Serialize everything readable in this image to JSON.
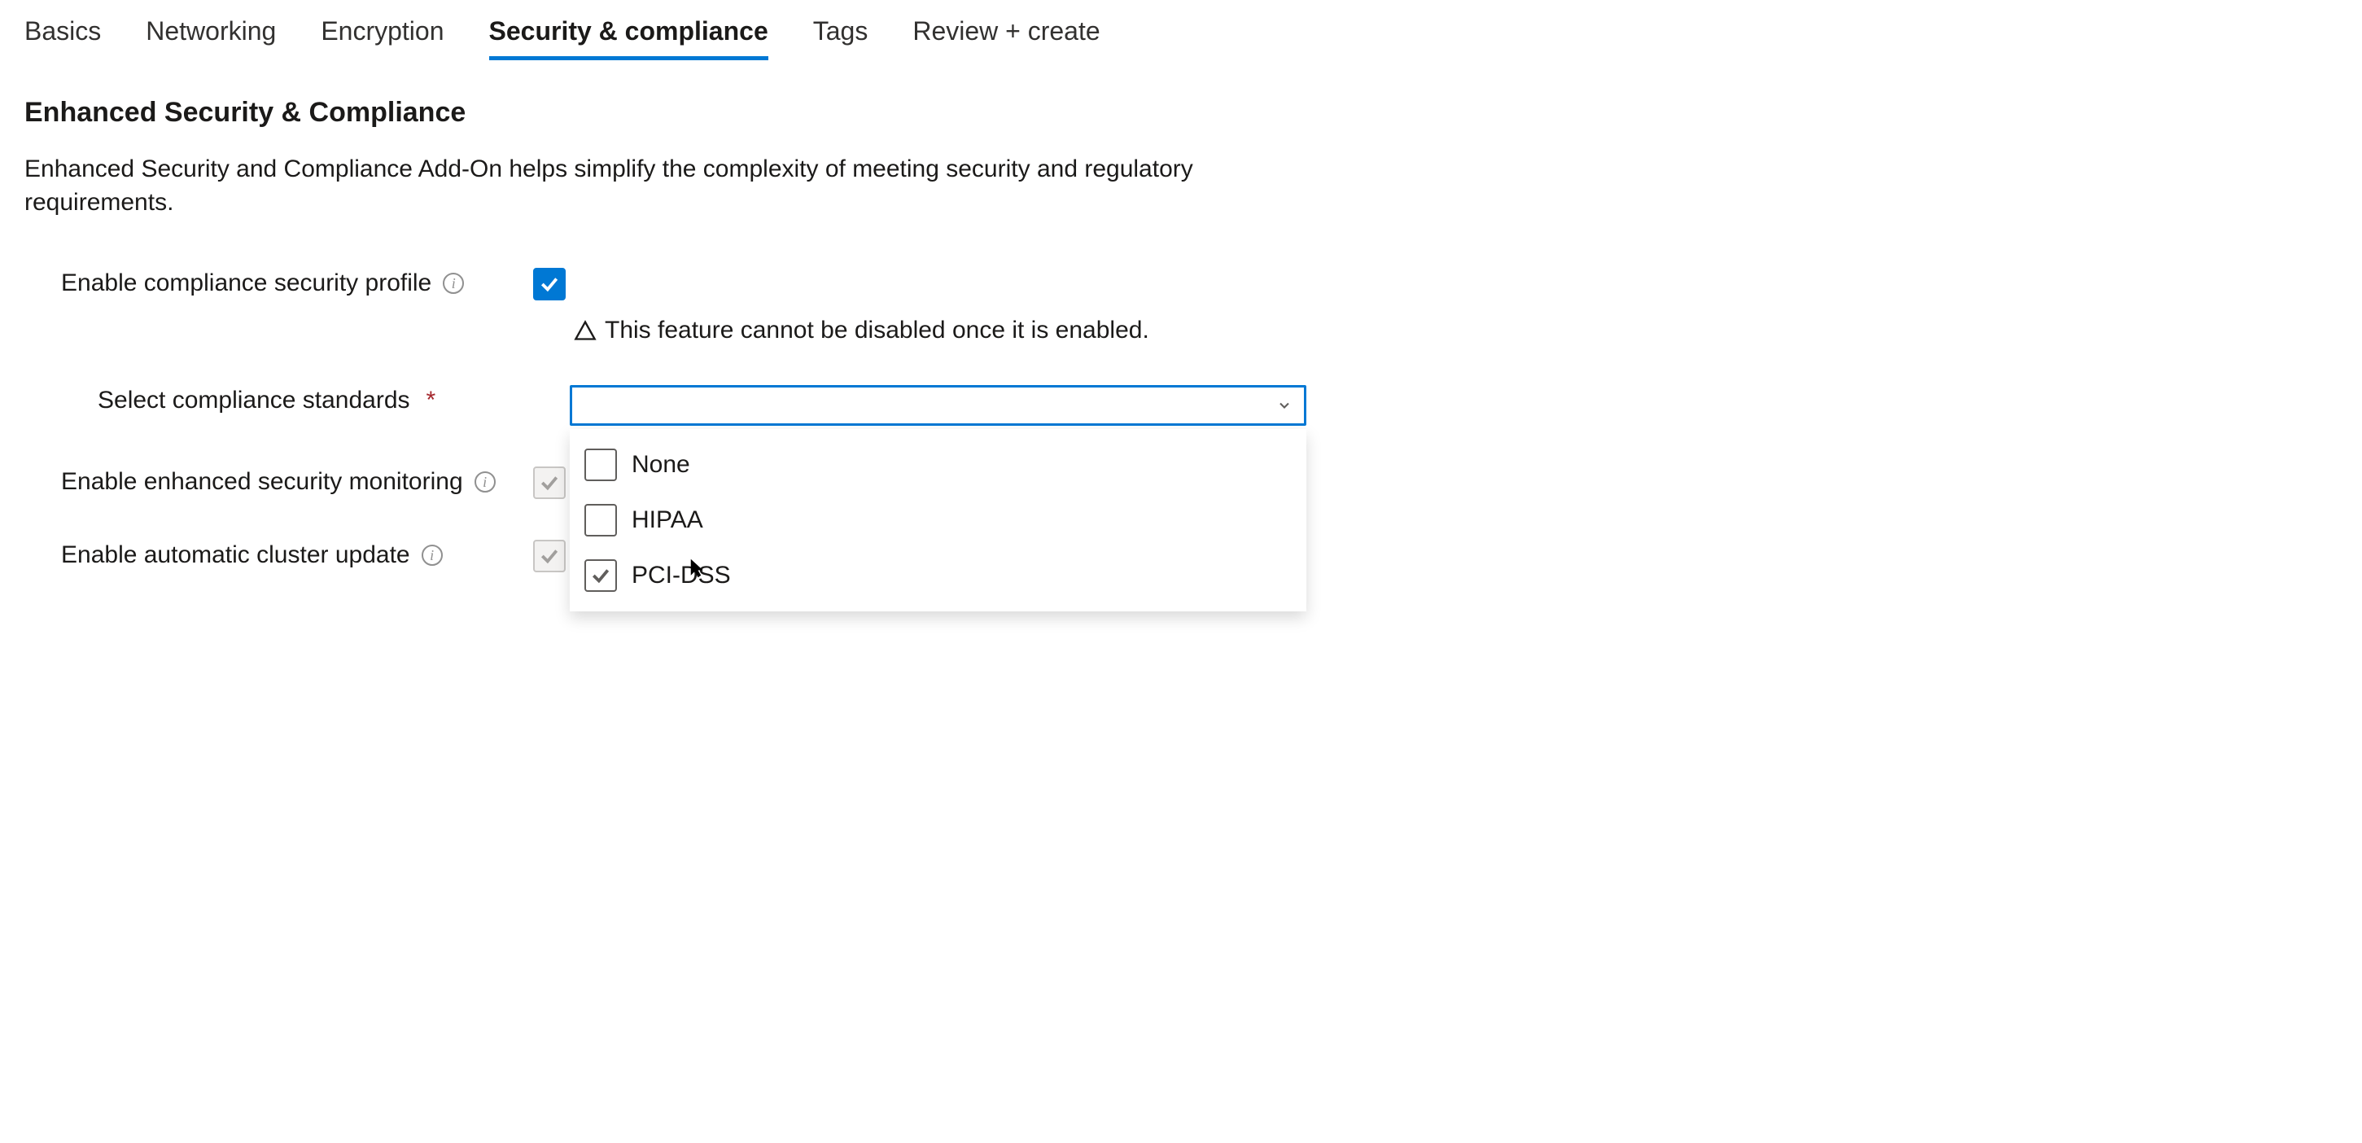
{
  "tabs": [
    {
      "label": "Basics",
      "active": false
    },
    {
      "label": "Networking",
      "active": false
    },
    {
      "label": "Encryption",
      "active": false
    },
    {
      "label": "Security & compliance",
      "active": true
    },
    {
      "label": "Tags",
      "active": false
    },
    {
      "label": "Review + create",
      "active": false
    }
  ],
  "section": {
    "title": "Enhanced Security & Compliance",
    "description": "Enhanced Security and Compliance Add-On helps simplify the complexity of meeting security and regulatory requirements."
  },
  "fields": {
    "profile": {
      "label": "Enable compliance security profile",
      "checked": true,
      "warning": "This feature cannot be disabled once it is enabled."
    },
    "standards": {
      "label": "Select compliance standards",
      "required": true,
      "options": [
        {
          "label": "None",
          "checked": false
        },
        {
          "label": "HIPAA",
          "checked": false
        },
        {
          "label": "PCI-DSS",
          "checked": true
        }
      ]
    },
    "monitoring": {
      "label": "Enable enhanced security monitoring",
      "checked": true,
      "disabled": true
    },
    "autoupdate": {
      "label": "Enable automatic cluster update",
      "checked": true,
      "disabled": true
    }
  },
  "colors": {
    "accent": "#0078d4",
    "required": "#a4262c"
  }
}
